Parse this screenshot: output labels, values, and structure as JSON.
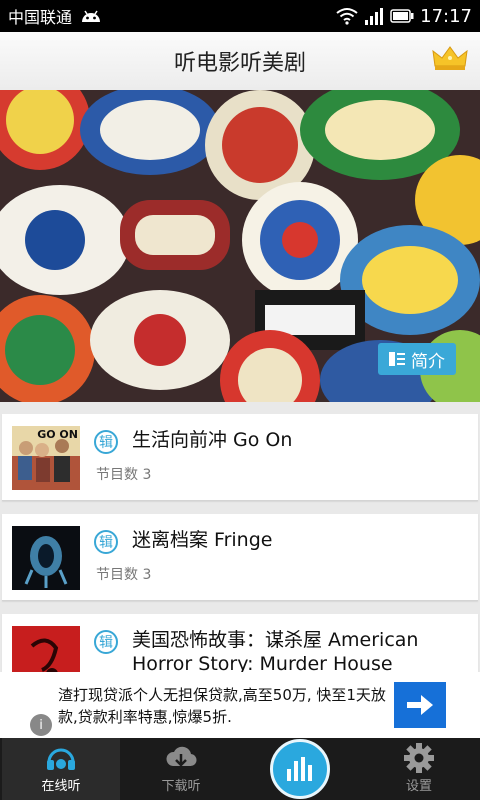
{
  "status_bar": {
    "carrier": "中国联通",
    "time": "17:17"
  },
  "header": {
    "title": "听电影听美剧",
    "crown_icon": "crown-icon"
  },
  "banner": {
    "intro_label": "简介",
    "image": "scout-patches-collage"
  },
  "shows": [
    {
      "name": "生活向前冲 Go On",
      "badge": "辑",
      "count": "节目数 3",
      "thumb_text": "GO ON"
    },
    {
      "name": "迷离档案 Fringe",
      "badge": "辑",
      "count": "节目数 3"
    },
    {
      "name": "美国恐怖故事：谋杀屋 American Horror Story: Murder House",
      "badge": "辑"
    }
  ],
  "ad": {
    "text": "渣打现贷派个人无担保贷款,高至50万, 快至1天放款,贷款利率特惠,惊爆5折.",
    "info": "i"
  },
  "tabs": [
    {
      "label": "在线听",
      "icon": "headphones-icon"
    },
    {
      "label": "下载听",
      "icon": "download-icon"
    },
    {
      "label": "设置",
      "icon": "gear-icon"
    }
  ],
  "colors": {
    "accent": "#2aa8de",
    "ad_button": "#1670d8"
  }
}
